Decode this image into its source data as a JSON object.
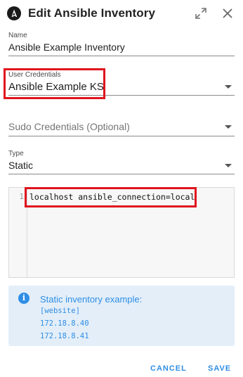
{
  "dialog": {
    "title": "Edit Ansible Inventory",
    "logo_icon": "ansible-logo-icon",
    "expand_icon": "expand-icon",
    "close_icon": "close-icon"
  },
  "form": {
    "name": {
      "label": "Name",
      "value": "Ansible Example Inventory"
    },
    "user_credentials": {
      "label": "User Credentials",
      "value": "Ansible Example KS"
    },
    "sudo_credentials": {
      "placeholder": "Sudo Credentials (Optional)"
    },
    "type": {
      "label": "Type",
      "value": "Static"
    }
  },
  "editor": {
    "lines": [
      {
        "number": "1",
        "text": "localhost ansible_connection=local"
      }
    ]
  },
  "info": {
    "icon": "info-icon",
    "title": "Static inventory example:",
    "lines": [
      "[website]",
      "172.18.8.40",
      "172.18.8.41"
    ]
  },
  "actions": {
    "cancel": "CANCEL",
    "save": "SAVE"
  },
  "colors": {
    "accent": "#2f8ee5",
    "highlight": "#e0141e",
    "info_bg": "#e3eef9"
  }
}
